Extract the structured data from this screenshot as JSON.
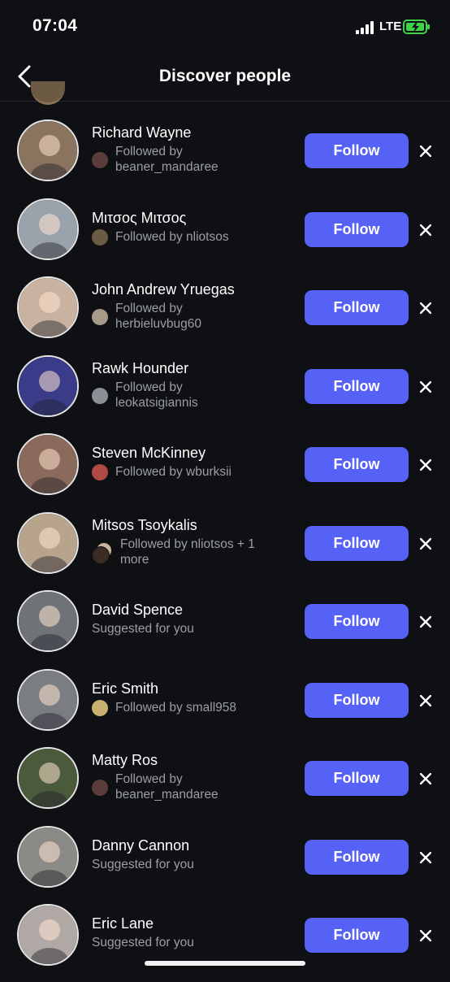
{
  "status": {
    "time": "07:04",
    "network": "LTE"
  },
  "header": {
    "title": "Discover people",
    "back_icon": "chevron-left-icon"
  },
  "follow_label": "Follow",
  "people": [
    {
      "name": "Richard Wayne",
      "subtitle": "Followed by beaner_mandaree",
      "type": "followed",
      "avatar_color": "#8a7460",
      "mini_color": "#5a3d3a"
    },
    {
      "name": "Μιτσος Μιτσος",
      "subtitle": "Followed by nliotsos",
      "type": "followed",
      "avatar_color": "#9aa3ab",
      "mini_color": "#6b5a44"
    },
    {
      "name": "John Andrew Yruegas",
      "subtitle": "Followed by herbieluvbug60",
      "type": "followed",
      "avatar_color": "#c9b3a0",
      "mini_color": "#a89a8a"
    },
    {
      "name": "Rawk Hounder",
      "subtitle": "Followed by leokatsigiannis",
      "type": "followed",
      "avatar_color": "#3a3c8a",
      "mini_color": "#8b8f96"
    },
    {
      "name": "Steven McKinney",
      "subtitle": "Followed by wburksii",
      "type": "followed",
      "avatar_color": "#8a6a5a",
      "mini_color": "#b04a44"
    },
    {
      "name": "Mitsos Tsoykalis",
      "subtitle": "Followed by nliotsos + 1 more",
      "type": "followed-multi",
      "avatar_color": "#b8a48c",
      "mini_color": "#3a2c22"
    },
    {
      "name": "David Spence",
      "subtitle": "Suggested for you",
      "type": "suggested",
      "avatar_color": "#6f7378"
    },
    {
      "name": "Eric Smith",
      "subtitle": "Followed by small958",
      "type": "followed",
      "avatar_color": "#7a7d82",
      "mini_color": "#c8b070"
    },
    {
      "name": "Matty Ros",
      "subtitle": "Followed by beaner_mandaree",
      "type": "followed",
      "avatar_color": "#4a5a3a",
      "mini_color": "#5a3d3a"
    },
    {
      "name": "Danny Cannon",
      "subtitle": "Suggested for you",
      "type": "suggested",
      "avatar_color": "#8c8a86"
    },
    {
      "name": "Eric Lane",
      "subtitle": "Suggested for you",
      "type": "suggested",
      "avatar_color": "#b0a8a4"
    }
  ]
}
